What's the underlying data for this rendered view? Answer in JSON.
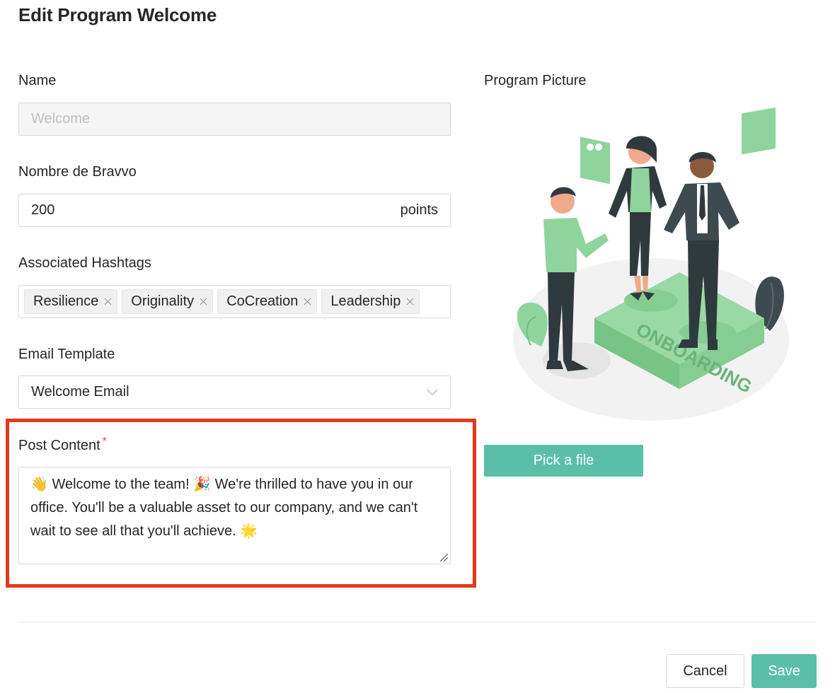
{
  "modal": {
    "title": "Edit Program Welcome"
  },
  "form": {
    "name": {
      "label": "Name",
      "value": "Welcome"
    },
    "bravvo": {
      "label": "Nombre de Bravvo",
      "value": "200",
      "suffix": "points"
    },
    "hashtags": {
      "label": "Associated Hashtags",
      "items": [
        {
          "label": "Resilience"
        },
        {
          "label": "Originality"
        },
        {
          "label": "CoCreation"
        },
        {
          "label": "Leadership"
        }
      ]
    },
    "email_template": {
      "label": "Email Template",
      "value": "Welcome Email"
    },
    "post_content": {
      "label": "Post Content",
      "required_mark": "*",
      "value": "👋 Welcome to the team! 🎉 We're thrilled to have you in our office. You'll be a valuable asset to our company, and we can't wait to see all that you'll achieve. 🌟"
    }
  },
  "picture": {
    "label": "Program Picture",
    "illustration_text": "ONBOARDING",
    "pick_label": "Pick a file"
  },
  "footer": {
    "cancel_label": "Cancel",
    "save_label": "Save"
  },
  "colors": {
    "accent": "#5bbfa8",
    "highlight": "#e2391f",
    "illustration_green": "#8fd49c"
  }
}
